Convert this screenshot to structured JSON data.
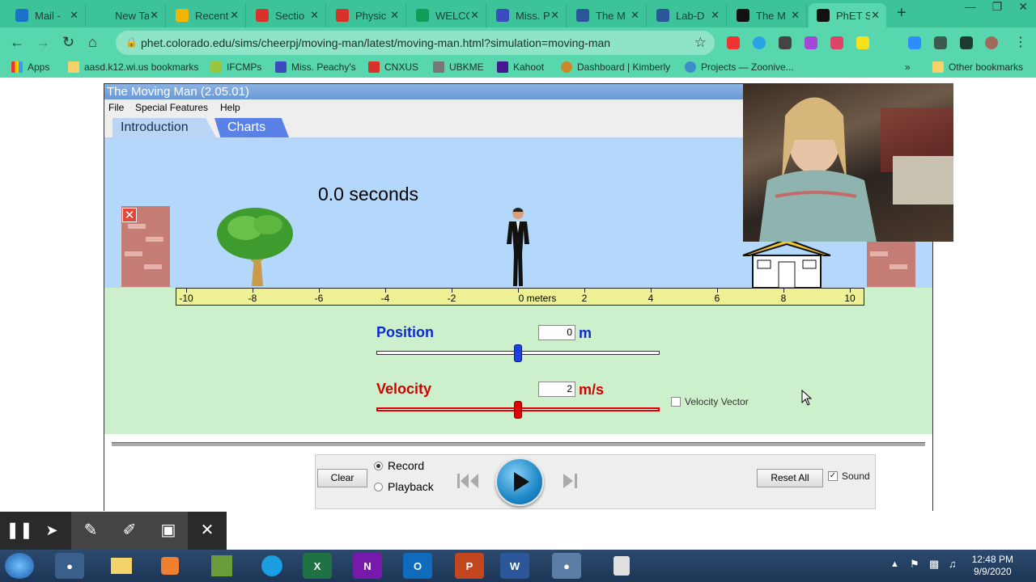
{
  "browser": {
    "tabs": [
      {
        "title": "Mail -",
        "icon": "outlook-icon",
        "color": "#1a73c8"
      },
      {
        "title": "New Tab",
        "icon": "new-tab-icon",
        "color": "#3cc39a"
      },
      {
        "title": "Recent",
        "icon": "google-drive-icon",
        "color": "#f4b400"
      },
      {
        "title": "Sectio",
        "icon": "x-logo-icon",
        "color": "#d9322b"
      },
      {
        "title": "Physic",
        "icon": "x-logo-icon",
        "color": "#d9322b"
      },
      {
        "title": "WELCO",
        "icon": "sheets-icon",
        "color": "#0f9d58"
      },
      {
        "title": "Miss. P",
        "icon": "classroom-icon",
        "color": "#3b4cbf"
      },
      {
        "title": "The M",
        "icon": "word-icon",
        "color": "#2b579a"
      },
      {
        "title": "Lab-D",
        "icon": "word-icon",
        "color": "#2b579a"
      },
      {
        "title": "The M",
        "icon": "phet-icon",
        "color": "#111111"
      },
      {
        "title": "PhET S",
        "icon": "phet-icon",
        "color": "#111111"
      }
    ],
    "url": "phet.colorado.edu/sims/cheerpj/moving-man/latest/moving-man.html?simulation=moving-man",
    "bookmarks": [
      "Apps",
      "aasd.k12.wi.us bookmarks",
      "IFCMPs",
      "Miss. Peachy's",
      "CNXUS",
      "UBKME",
      "Kahoot",
      "Dashboard | Kimberly",
      "Projects — Zoonive..."
    ],
    "other_bookmarks": "Other bookmarks"
  },
  "app": {
    "title": "The Moving Man (2.05.01)",
    "menu": [
      "File",
      "Special Features",
      "Help"
    ],
    "tabs": {
      "intro": "Introduction",
      "charts": "Charts"
    },
    "time_display": "0.0 seconds",
    "ruler": {
      "labels": [
        "-10",
        "-8",
        "-6",
        "-4",
        "-2",
        "0 meters",
        "2",
        "4",
        "6",
        "8",
        "10"
      ]
    },
    "position": {
      "label": "Position",
      "value": "0",
      "unit": "m",
      "slider_value": 0,
      "range": [
        -10,
        10
      ],
      "color": "#0a2bd1"
    },
    "velocity": {
      "label": "Velocity",
      "value": "2",
      "unit": "m/s",
      "slider_value": 0,
      "range": [
        -15,
        15
      ],
      "color": "#d40000"
    },
    "velocity_vector_label": "Velocity Vector",
    "bottom": {
      "clear": "Clear",
      "record": "Record",
      "playback": "Playback",
      "reset_all": "Reset All",
      "sound": "Sound"
    }
  },
  "taskbar": {
    "time": "12:48 PM",
    "date": "9/9/2020"
  }
}
